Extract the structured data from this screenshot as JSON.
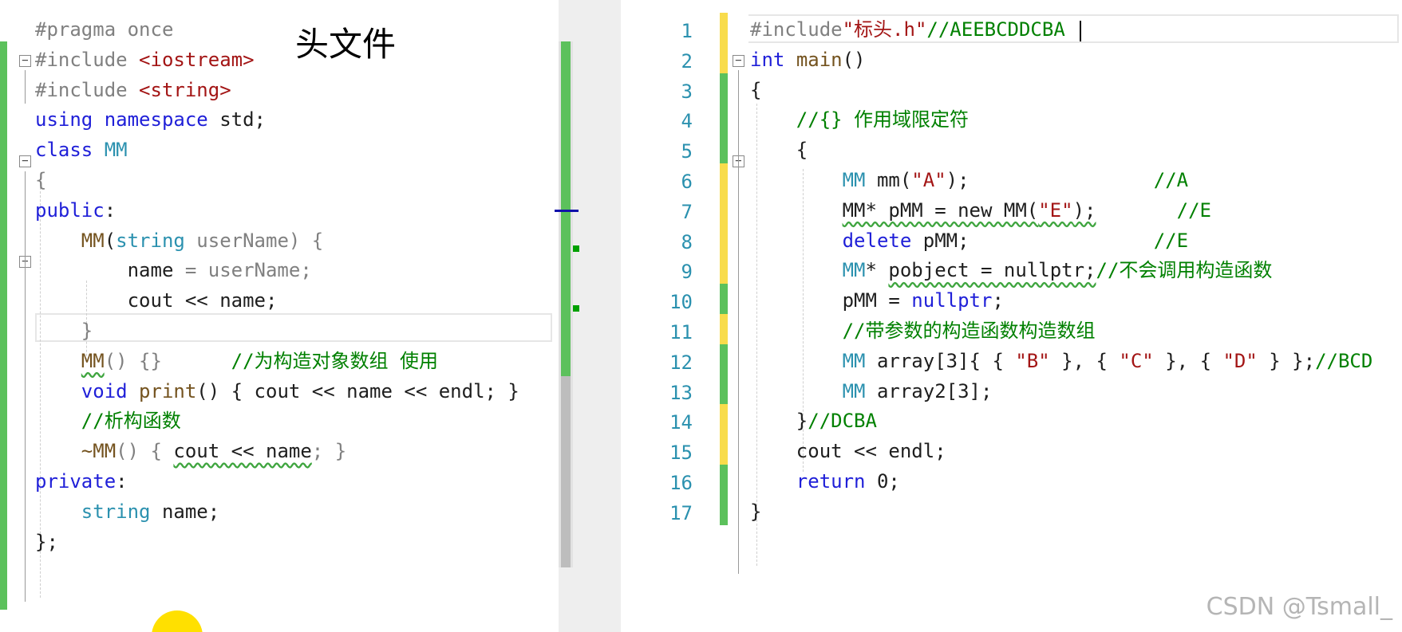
{
  "header_note": "头文件",
  "left_code": [
    {
      "parts": [
        {
          "t": "#pragma once",
          "c": "pp"
        }
      ]
    },
    {
      "parts": [
        {
          "t": "#include ",
          "c": "pp"
        },
        {
          "t": "<iostream>",
          "c": "str"
        }
      ]
    },
    {
      "parts": [
        {
          "t": "#include ",
          "c": "pp"
        },
        {
          "t": "<string>",
          "c": "str"
        }
      ]
    },
    {
      "parts": [
        {
          "t": "using",
          "c": "kw"
        },
        {
          "t": " ",
          "c": ""
        },
        {
          "t": "namespace",
          "c": "kw"
        },
        {
          "t": " std;",
          "c": ""
        }
      ]
    },
    {
      "parts": [
        {
          "t": "class",
          "c": "kw"
        },
        {
          "t": " ",
          "c": ""
        },
        {
          "t": "MM",
          "c": "ty"
        }
      ]
    },
    {
      "parts": [
        {
          "t": "{",
          "c": "pm"
        }
      ]
    },
    {
      "parts": [
        {
          "t": "public",
          "c": "kw"
        },
        {
          "t": ":",
          "c": ""
        }
      ]
    },
    {
      "parts": [
        {
          "t": "    ",
          "c": ""
        },
        {
          "t": "MM",
          "c": "fn"
        },
        {
          "t": "(",
          "c": ""
        },
        {
          "t": "string",
          "c": "ty"
        },
        {
          "t": " userName) {",
          "c": "pm"
        }
      ]
    },
    {
      "parts": [
        {
          "t": "        ",
          "c": ""
        },
        {
          "t": "name",
          "c": ""
        },
        {
          "t": " = userName;",
          "c": "pm"
        }
      ]
    },
    {
      "parts": [
        {
          "t": "        ",
          "c": ""
        },
        {
          "t": "cout << name;",
          "c": ""
        }
      ]
    },
    {
      "parts": [
        {
          "t": "    }",
          "c": "pm"
        }
      ]
    },
    {
      "parts": [
        {
          "t": "    ",
          "c": ""
        },
        {
          "t": "MM",
          "c": "fn sq"
        },
        {
          "t": "() {}      ",
          "c": "pm"
        },
        {
          "t": "//为构造对象数组 使用",
          "c": "cm"
        }
      ]
    },
    {
      "parts": [
        {
          "t": "    ",
          "c": ""
        },
        {
          "t": "void",
          "c": "kw"
        },
        {
          "t": " ",
          "c": ""
        },
        {
          "t": "print",
          "c": "fn"
        },
        {
          "t": "() { cout << name << endl; }",
          "c": ""
        }
      ]
    },
    {
      "parts": [
        {
          "t": "    ",
          "c": ""
        },
        {
          "t": "//析构函数",
          "c": "cm"
        }
      ]
    },
    {
      "parts": [
        {
          "t": "    ",
          "c": ""
        },
        {
          "t": "~MM",
          "c": "fn"
        },
        {
          "t": "() { ",
          "c": "pm"
        },
        {
          "t": "cout << name",
          "c": "sq"
        },
        {
          "t": "; }",
          "c": "pm"
        }
      ]
    },
    {
      "parts": [
        {
          "t": "private",
          "c": "kw"
        },
        {
          "t": ":",
          "c": ""
        }
      ]
    },
    {
      "parts": [
        {
          "t": "    ",
          "c": ""
        },
        {
          "t": "string",
          "c": "ty"
        },
        {
          "t": " name;",
          "c": ""
        }
      ]
    },
    {
      "parts": [
        {
          "t": "};",
          "c": ""
        }
      ]
    }
  ],
  "right_line_numbers": [
    "1",
    "2",
    "3",
    "4",
    "5",
    "6",
    "7",
    "8",
    "9",
    "10",
    "11",
    "12",
    "13",
    "14",
    "15",
    "16",
    "17"
  ],
  "right_code": [
    {
      "parts": [
        {
          "t": "#include",
          "c": "pp"
        },
        {
          "t": "\"标头.h\"",
          "c": "str"
        },
        {
          "t": "//AEEBCDDCBA",
          "c": "cm"
        }
      ]
    },
    {
      "parts": [
        {
          "t": "int",
          "c": "kw"
        },
        {
          "t": " ",
          "c": ""
        },
        {
          "t": "main",
          "c": "fn"
        },
        {
          "t": "()",
          "c": ""
        }
      ]
    },
    {
      "parts": [
        {
          "t": "{",
          "c": ""
        }
      ]
    },
    {
      "parts": [
        {
          "t": "    ",
          "c": ""
        },
        {
          "t": "//{} 作用域限定符",
          "c": "cm"
        }
      ]
    },
    {
      "parts": [
        {
          "t": "    {",
          "c": ""
        }
      ]
    },
    {
      "parts": [
        {
          "t": "        ",
          "c": ""
        },
        {
          "t": "MM",
          "c": "ty"
        },
        {
          "t": " mm(",
          "c": ""
        },
        {
          "t": "\"A\"",
          "c": "str"
        },
        {
          "t": ");                ",
          "c": ""
        },
        {
          "t": "//A",
          "c": "cm"
        }
      ]
    },
    {
      "parts": [
        {
          "t": "        ",
          "c": ""
        },
        {
          "t": "MM* pMM = new MM(",
          "c": "sq"
        },
        {
          "t": "\"E\"",
          "c": "str sq"
        },
        {
          "t": ");",
          "c": "sq"
        },
        {
          "t": "       ",
          "c": ""
        },
        {
          "t": "//E",
          "c": "cm"
        }
      ]
    },
    {
      "parts": [
        {
          "t": "        ",
          "c": ""
        },
        {
          "t": "delete",
          "c": "kw"
        },
        {
          "t": " pMM;",
          "c": ""
        },
        {
          "t": "                ",
          "c": ""
        },
        {
          "t": "//E",
          "c": "cm"
        }
      ]
    },
    {
      "parts": [
        {
          "t": "        ",
          "c": ""
        },
        {
          "t": "MM",
          "c": "ty"
        },
        {
          "t": "* ",
          "c": ""
        },
        {
          "t": "pobject = nullptr;",
          "c": "sq"
        },
        {
          "t": "//不会调用构造函数",
          "c": "cm"
        }
      ]
    },
    {
      "parts": [
        {
          "t": "        ",
          "c": ""
        },
        {
          "t": "pMM = ",
          "c": ""
        },
        {
          "t": "nullptr",
          "c": "kw"
        },
        {
          "t": ";",
          "c": ""
        }
      ]
    },
    {
      "parts": [
        {
          "t": "        ",
          "c": ""
        },
        {
          "t": "//带参数的构造函数构造数组",
          "c": "cm"
        }
      ]
    },
    {
      "parts": [
        {
          "t": "        ",
          "c": ""
        },
        {
          "t": "MM",
          "c": "ty"
        },
        {
          "t": " array[3]{ { ",
          "c": ""
        },
        {
          "t": "\"B\"",
          "c": "str"
        },
        {
          "t": " }, { ",
          "c": ""
        },
        {
          "t": "\"C\"",
          "c": "str"
        },
        {
          "t": " }, { ",
          "c": ""
        },
        {
          "t": "\"D\"",
          "c": "str"
        },
        {
          "t": " } };",
          "c": ""
        },
        {
          "t": "//BCD",
          "c": "cm"
        }
      ]
    },
    {
      "parts": [
        {
          "t": "        ",
          "c": ""
        },
        {
          "t": "MM",
          "c": "ty"
        },
        {
          "t": " array2[3];",
          "c": ""
        }
      ]
    },
    {
      "parts": [
        {
          "t": "    }",
          "c": ""
        },
        {
          "t": "//DCBA",
          "c": "cm"
        }
      ]
    },
    {
      "parts": [
        {
          "t": "    cout << endl;",
          "c": ""
        }
      ]
    },
    {
      "parts": [
        {
          "t": "    ",
          "c": ""
        },
        {
          "t": "return",
          "c": "kw"
        },
        {
          "t": " 0;",
          "c": ""
        }
      ]
    },
    {
      "parts": [
        {
          "t": "}",
          "c": ""
        }
      ]
    }
  ],
  "right_markers": [
    "y",
    "y",
    "g",
    "g",
    "g",
    "y",
    "y",
    "y",
    "y",
    "g",
    "y",
    "g",
    "g",
    "y",
    "y",
    "g",
    "g"
  ],
  "watermark": "CSDN @Tsmall_",
  "colors": {
    "keyword": "#1f1fd8",
    "type": "#2b91af",
    "string": "#a31515",
    "comment": "#008000",
    "change_saved": "#5cc15c",
    "change_unsaved": "#f8dc4c"
  }
}
